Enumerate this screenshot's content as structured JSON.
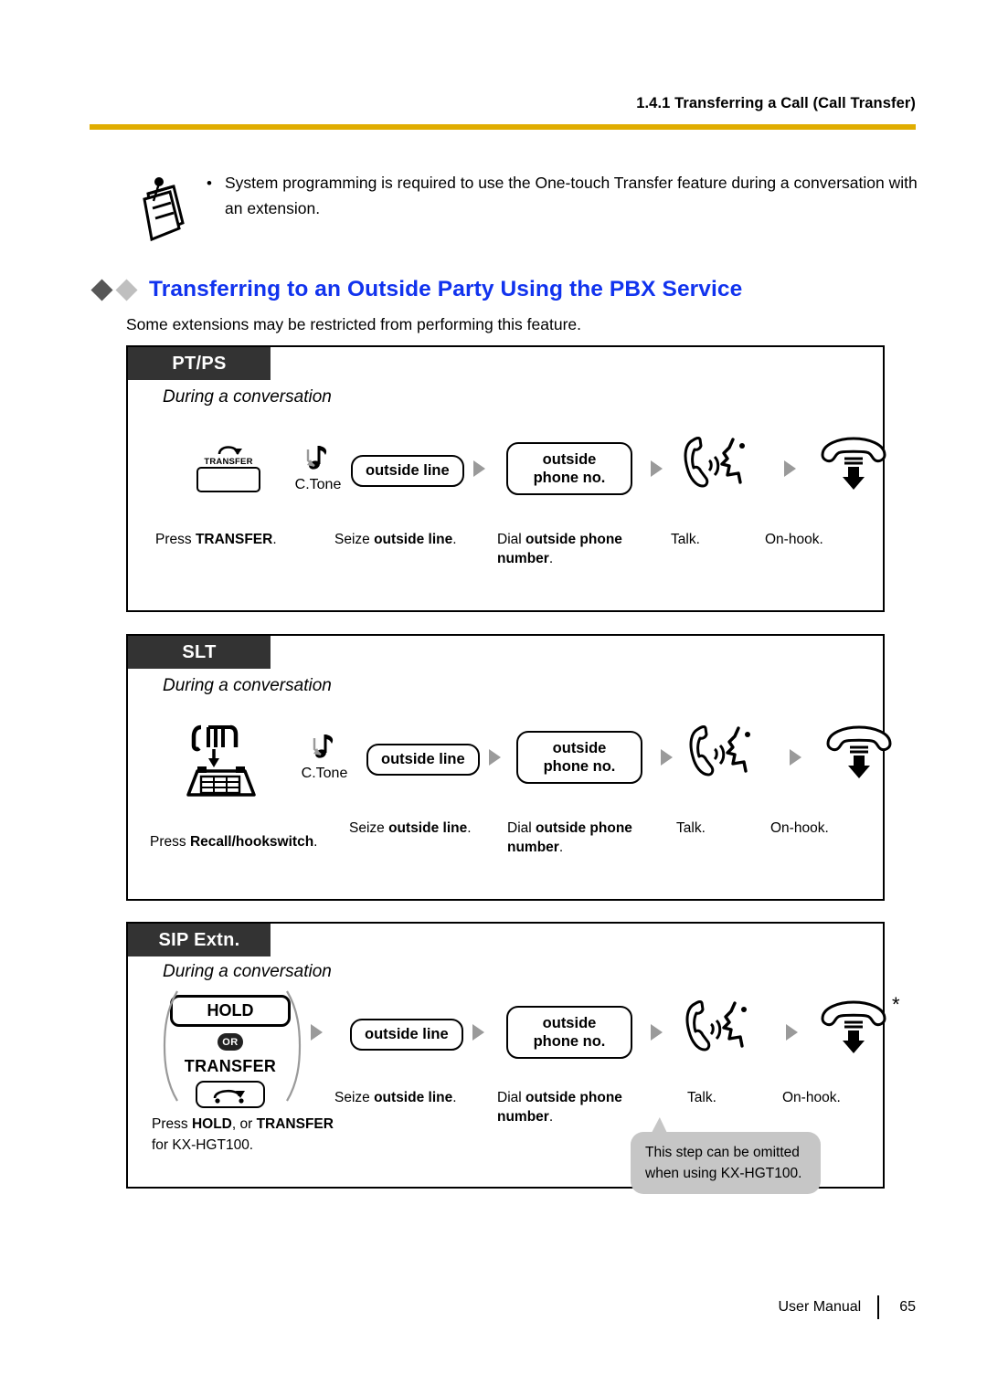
{
  "header": {
    "section_ref": "1.4.1 Transferring a Call (Call Transfer)",
    "rule_color": "#E0AD00"
  },
  "note": {
    "icon": "note-pad-icon",
    "bullet": "•",
    "text": "System programming is required to use the One-touch Transfer feature during a conversation with an extension."
  },
  "section": {
    "title": "Transferring to an Outside Party Using the PBX Service",
    "title_color": "#1133EE",
    "diamond_dark": "#575757",
    "diamond_light": "#BFBFBF",
    "subtitle": "Some extensions may be restricted from performing this feature."
  },
  "boxes": [
    {
      "tab": "PT/PS",
      "during": "During a conversation",
      "steps": [
        {
          "kind": "transfer-key",
          "key_label": "TRANSFER",
          "caption_plain1": "Press ",
          "caption_bold": "TRANSFER",
          "caption_plain2": "."
        },
        {
          "kind": "tone",
          "label": "C.Tone"
        },
        {
          "kind": "pill",
          "label": "outside line",
          "caption_plain1": "Seize ",
          "caption_bold": "outside line",
          "caption_plain2": "."
        },
        {
          "kind": "pill2",
          "line1": "outside",
          "line2": "phone no.",
          "caption_plain1": "Dial ",
          "caption_bold": "outside phone number",
          "caption_plain2": "."
        },
        {
          "kind": "talk-icon",
          "caption_plain1": "Talk.",
          "caption_bold": "",
          "caption_plain2": ""
        },
        {
          "kind": "onhook-icon",
          "caption_plain1": "On-hook.",
          "caption_bold": "",
          "caption_plain2": ""
        }
      ]
    },
    {
      "tab": "SLT",
      "during": "During a conversation",
      "steps": [
        {
          "kind": "hookswitch-icon",
          "caption_plain1": "Press ",
          "caption_bold": "Recall/hookswitch",
          "caption_plain2": "."
        },
        {
          "kind": "tone",
          "label": "C.Tone"
        },
        {
          "kind": "pill",
          "label": "outside line",
          "caption_plain1": "Seize ",
          "caption_bold": "outside line",
          "caption_plain2": "."
        },
        {
          "kind": "pill2",
          "line1": "outside",
          "line2": "phone no.",
          "caption_plain1": "Dial ",
          "caption_bold": "outside phone number",
          "caption_plain2": "."
        },
        {
          "kind": "talk-icon",
          "caption_plain1": "Talk.",
          "caption_bold": "",
          "caption_plain2": ""
        },
        {
          "kind": "onhook-icon",
          "caption_plain1": "On-hook.",
          "caption_bold": "",
          "caption_plain2": ""
        }
      ]
    },
    {
      "tab": "SIP Extn.",
      "during": "During a conversation",
      "hold_label": "HOLD",
      "or_label": "OR",
      "transfer_label": "TRANSFER",
      "press_line1_plain1": "Press ",
      "press_line1_bold1": "HOLD",
      "press_line1_plain2": ", or ",
      "press_line1_bold2": "TRANSFER",
      "press_line2": "for KX-HGT100.",
      "asterisk": "*",
      "steps": [
        {
          "kind": "pill",
          "label": "outside line",
          "caption_plain1": "Seize ",
          "caption_bold": "outside line",
          "caption_plain2": "."
        },
        {
          "kind": "pill2",
          "line1": "outside",
          "line2": "phone no.",
          "caption_plain1": "Dial ",
          "caption_bold": "outside phone number",
          "caption_plain2": "."
        },
        {
          "kind": "talk-icon",
          "caption_plain1": "Talk.",
          "caption_bold": "",
          "caption_plain2": ""
        },
        {
          "kind": "onhook-icon",
          "caption_plain1": "On-hook.",
          "caption_bold": "",
          "caption_plain2": ""
        }
      ],
      "callout": {
        "line1": "This step can be omitted",
        "line2": "when using KX-HGT100.",
        "bg": "#C6C6C6"
      }
    }
  ],
  "footer": {
    "manual_label": "User Manual",
    "page_number": "65"
  }
}
